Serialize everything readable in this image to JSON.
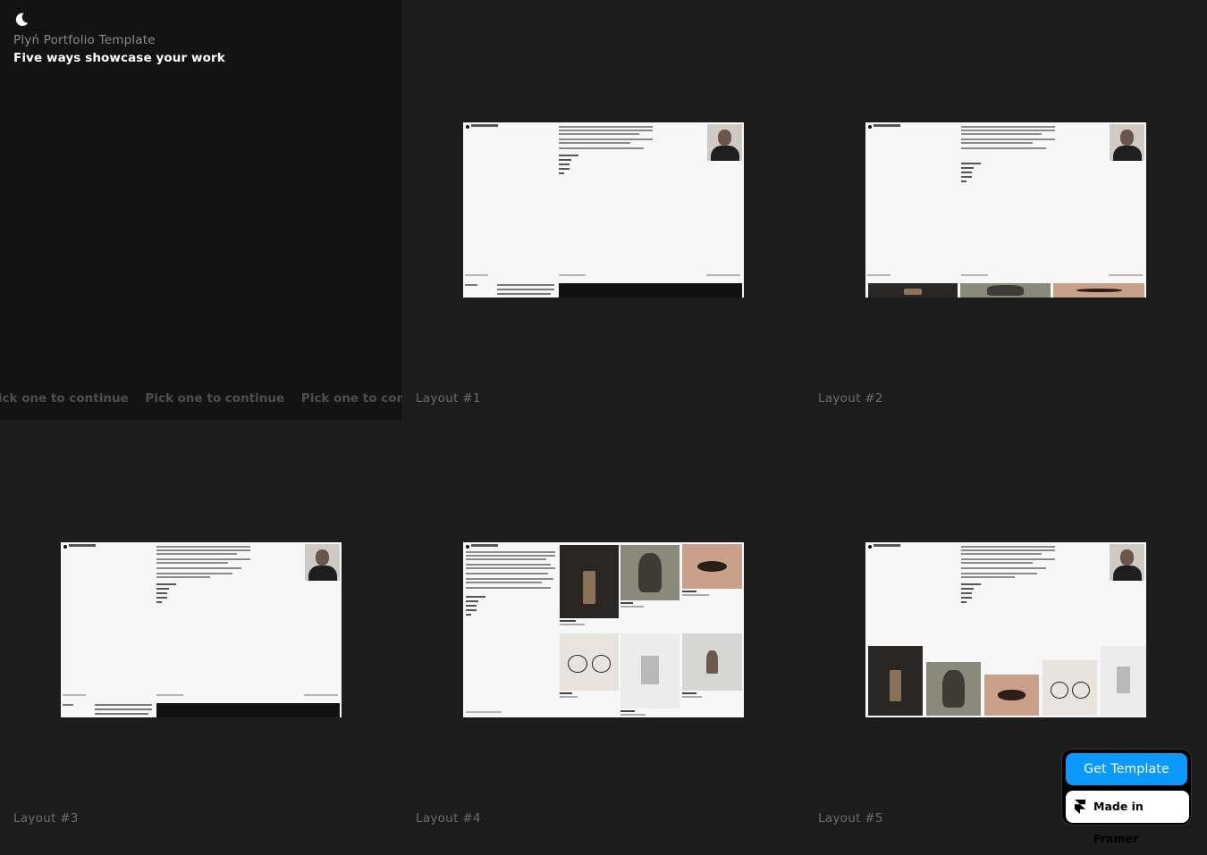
{
  "intro": {
    "title": "Plyń Portfolio Template",
    "subtitle": "Five ways showcase your work",
    "marquee": [
      "Pick one to continue",
      "Pick one to continue",
      "Pick one to continue"
    ]
  },
  "layouts": [
    {
      "label": "Layout #1"
    },
    {
      "label": "Layout #2"
    },
    {
      "label": "Layout #3"
    },
    {
      "label": "Layout #4"
    },
    {
      "label": "Layout #5"
    }
  ],
  "actions": {
    "get_template": "Get Template",
    "made_in_framer": "Made in Framer"
  },
  "colors": {
    "accent": "#0b99ff",
    "background": "#1c1c1c",
    "intro_panel": "#131313"
  },
  "icons": {
    "theme": "moon-icon",
    "framer": "framer-logo-icon"
  }
}
